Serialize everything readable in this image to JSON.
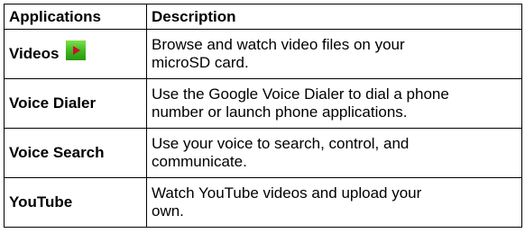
{
  "table": {
    "headers": [
      "Applications",
      "Description"
    ],
    "rows": [
      {
        "application": "Videos",
        "icon": "play-icon",
        "description_lines": [
          "Browse and watch video files on your",
          "microSD card."
        ]
      },
      {
        "application": "Voice Dialer",
        "description_lines": [
          "Use the Google Voice Dialer to dial a phone",
          "number or launch phone applications."
        ]
      },
      {
        "application": "Voice Search",
        "description_lines": [
          "Use your voice to search, control, and",
          "communicate."
        ]
      },
      {
        "application": "YouTube",
        "description_lines": [
          "Watch YouTube videos and upload your",
          "own."
        ]
      }
    ]
  },
  "colors": {
    "icon_green": "#3fb51f",
    "border": "#000000"
  }
}
